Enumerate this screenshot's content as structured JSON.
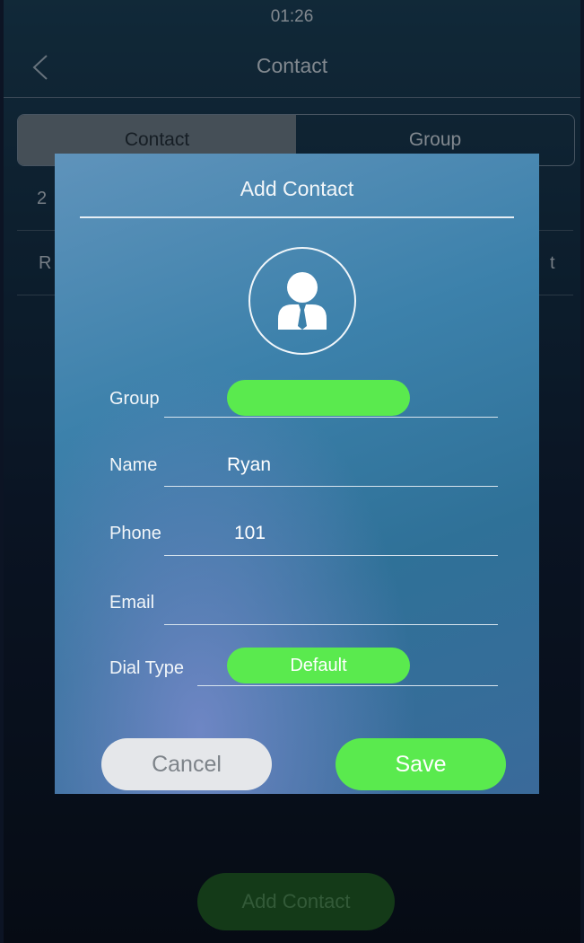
{
  "status_bar": {
    "time": "01:26"
  },
  "header": {
    "title": "Contact",
    "back_icon": "chevron-left-icon"
  },
  "tabs": [
    {
      "label": "Contact",
      "active": true
    },
    {
      "label": "Group",
      "active": false
    }
  ],
  "background_list": [
    {
      "left_text": "2",
      "right_text": ""
    },
    {
      "left_text": "R",
      "right_text": "t"
    }
  ],
  "bottom_action": {
    "label": "Add Contact"
  },
  "dialog": {
    "title": "Add Contact",
    "avatar_icon": "user-avatar-icon",
    "fields": {
      "group": {
        "label": "Group",
        "value": ""
      },
      "name": {
        "label": "Name",
        "value": "Ryan"
      },
      "phone": {
        "label": "Phone",
        "value": "101"
      },
      "email": {
        "label": "Email",
        "value": ""
      },
      "dial_type": {
        "label": "Dial Type",
        "value": "Default"
      }
    },
    "cancel_label": "Cancel",
    "save_label": "Save"
  },
  "colors": {
    "accent_green": "#5aea4e",
    "dialog_blue": "#3c81ab",
    "dim_green": "#1f5a26"
  }
}
